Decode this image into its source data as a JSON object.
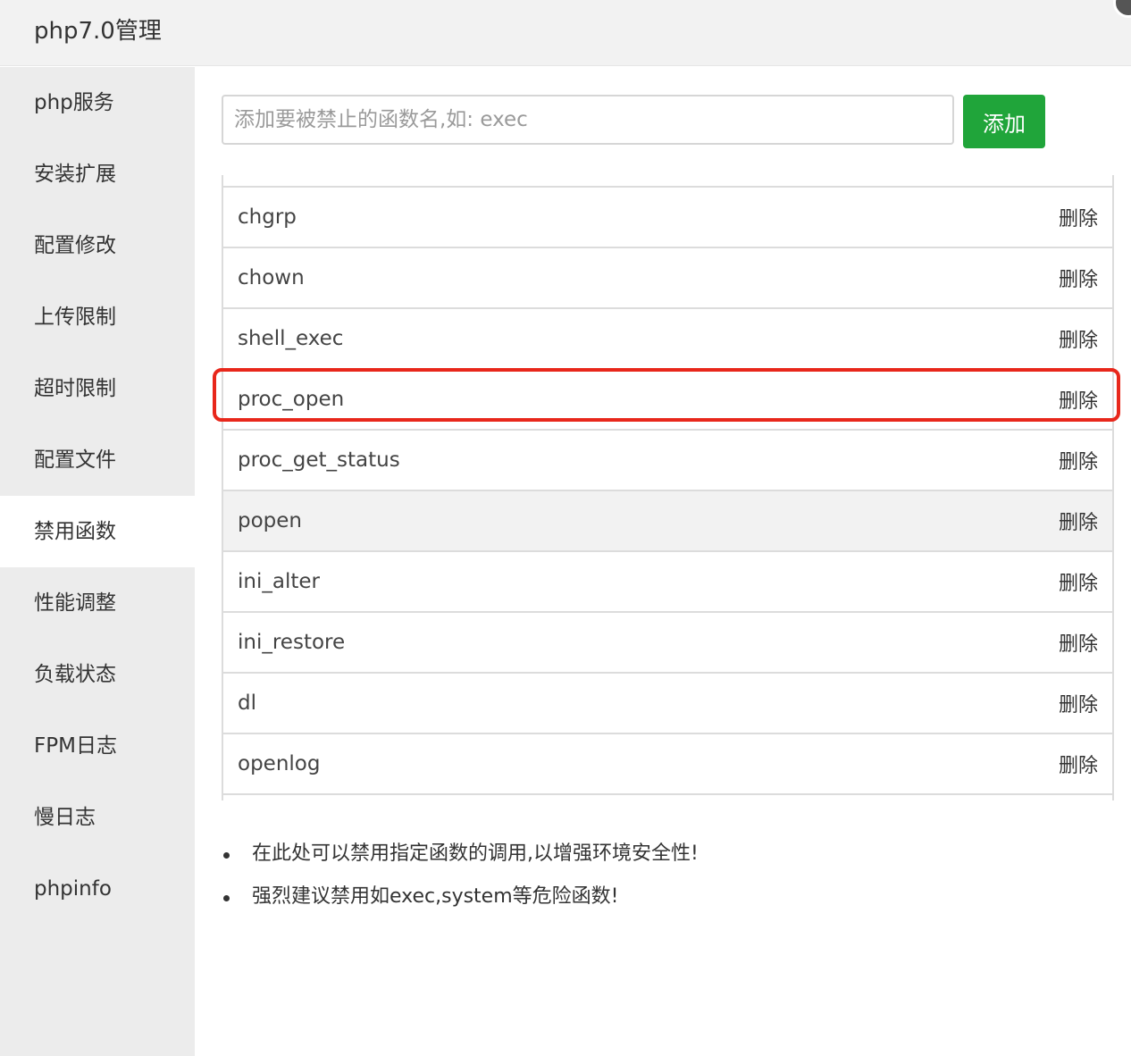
{
  "window": {
    "title": "php7.0管理"
  },
  "sidebar": {
    "items": [
      {
        "label": "php服务"
      },
      {
        "label": "安装扩展"
      },
      {
        "label": "配置修改"
      },
      {
        "label": "上传限制"
      },
      {
        "label": "超时限制"
      },
      {
        "label": "配置文件"
      },
      {
        "label": "禁用函数",
        "active": true
      },
      {
        "label": "性能调整"
      },
      {
        "label": "负载状态"
      },
      {
        "label": "FPM日志"
      },
      {
        "label": "慢日志"
      },
      {
        "label": "phpinfo"
      }
    ]
  },
  "search": {
    "placeholder": "添加要被禁止的函数名,如: exec",
    "value": ""
  },
  "toolbar": {
    "add_label": "添加"
  },
  "functions": [
    {
      "name": "chgrp",
      "action": "删除"
    },
    {
      "name": "chown",
      "action": "删除"
    },
    {
      "name": "shell_exec",
      "action": "删除"
    },
    {
      "name": "proc_open",
      "action": "删除",
      "highlighted": true
    },
    {
      "name": "proc_get_status",
      "action": "删除"
    },
    {
      "name": "popen",
      "action": "删除",
      "hover": true
    },
    {
      "name": "ini_alter",
      "action": "删除"
    },
    {
      "name": "ini_restore",
      "action": "删除"
    },
    {
      "name": "dl",
      "action": "删除"
    },
    {
      "name": "openlog",
      "action": "删除"
    }
  ],
  "tips": [
    "在此处可以禁用指定函数的调用,以增强环境安全性!",
    "强烈建议禁用如exec,system等危险函数!"
  ],
  "colors": {
    "accent": "#20a53a",
    "highlight": "#e8271b",
    "sidebar_bg": "#ececec"
  }
}
